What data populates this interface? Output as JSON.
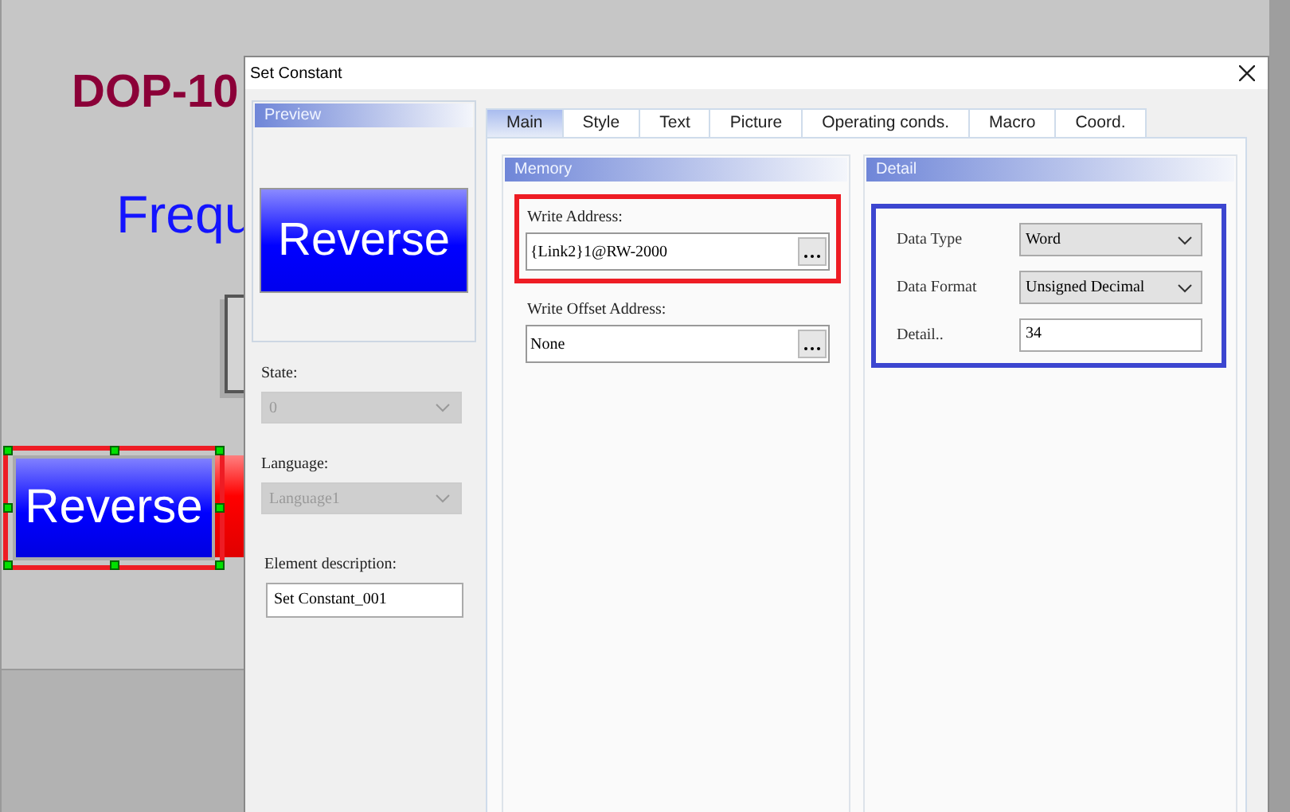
{
  "canvas": {
    "title": "DOP-10",
    "label": "Frequ",
    "button": {
      "label": "Reverse",
      "selected": true
    }
  },
  "dialog": {
    "title": "Set Constant",
    "preview": {
      "title": "Preview",
      "button_label": "Reverse"
    },
    "state": {
      "label": "State:",
      "value": "0",
      "disabled": true
    },
    "language": {
      "label": "Language:",
      "value": "Language1",
      "disabled": true
    },
    "description": {
      "label": "Element description:",
      "value": "Set Constant_001"
    },
    "tabs": [
      {
        "label": "Main",
        "selected": true
      },
      {
        "label": "Style",
        "selected": false
      },
      {
        "label": "Text",
        "selected": false
      },
      {
        "label": "Picture",
        "selected": false
      },
      {
        "label": "Operating conds.",
        "selected": false
      },
      {
        "label": "Macro",
        "selected": false
      },
      {
        "label": "Coord.",
        "selected": false
      }
    ],
    "memory": {
      "title": "Memory",
      "fields": [
        {
          "label": "Write Address:",
          "value": "{Link2}1@RW-2000",
          "highlighted": true
        },
        {
          "label": "Write Offset Address:",
          "value": "None",
          "highlighted": false
        }
      ]
    },
    "detail": {
      "title": "Detail",
      "highlighted": true,
      "fields": [
        {
          "kind": "dropdown",
          "label": "Data Type",
          "value": "Word"
        },
        {
          "kind": "dropdown",
          "label": "Data Format",
          "value": "Unsigned Decimal"
        },
        {
          "kind": "text",
          "label": "Detail..",
          "value": "34"
        }
      ]
    }
  }
}
